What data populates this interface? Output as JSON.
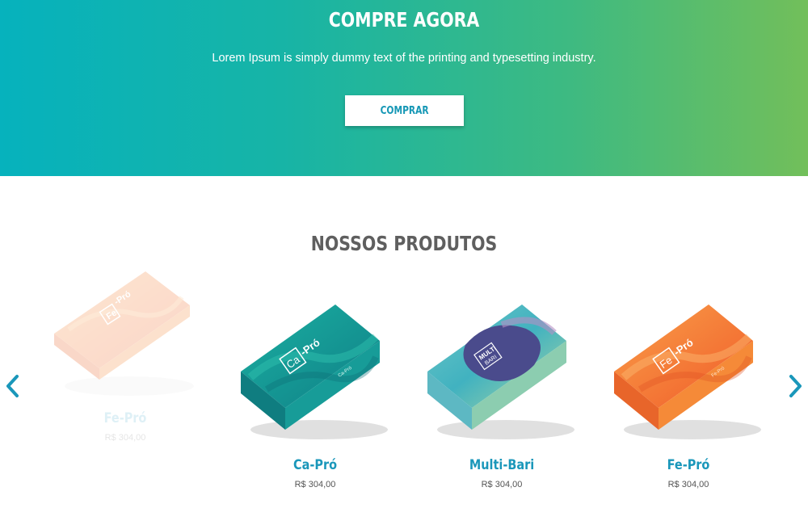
{
  "hero": {
    "title": "COMPRE AGORA",
    "text": "Lorem Ipsum is simply dummy text of the printing and typesetting industry.",
    "button_label": "COMPRAR"
  },
  "products": {
    "title": "NOSSOS PRODUTOS",
    "items": [
      {
        "name": "Fe-Pró",
        "price": "R$ 304,00",
        "box_label": "Fe-Pró",
        "color": "#f47a35"
      },
      {
        "name": "Ca-Pró",
        "price": "R$ 304,00",
        "box_label": "Ca-Pró",
        "color": "#149a8e"
      },
      {
        "name": "Multi-Bari",
        "price": "R$ 304,00",
        "box_label_top": "MULTI",
        "box_label_bottom": "BARI",
        "color": "#4c4d8e"
      },
      {
        "name": "Fe-Pró",
        "price": "R$ 304,00",
        "box_label": "Fe-Pró",
        "color": "#f47a35"
      }
    ]
  },
  "icons": {
    "prev": "chevron-left-icon",
    "next": "chevron-right-icon"
  },
  "colors": {
    "accent": "#1a97ba",
    "gradient_start": "#06b2bd",
    "gradient_end": "#72bf5a"
  }
}
